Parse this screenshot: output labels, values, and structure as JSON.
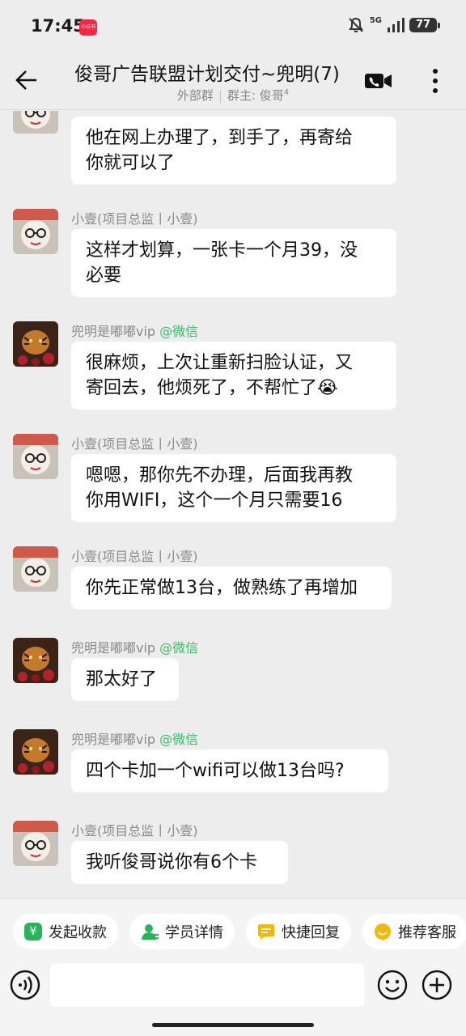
{
  "status_bar": {
    "time": "17:45",
    "app_badge": "小红书",
    "network": "5G",
    "battery": "77"
  },
  "header": {
    "title": "俊哥广告联盟计划交付~兜明(7)",
    "subtitle_group_type": "外部群",
    "subtitle_owner": "群主: 俊哥",
    "subtitle_owner_sup": "4"
  },
  "messages": [
    {
      "avatar": "avatar-glasses",
      "sender": "",
      "tag": "",
      "text_lines": [
        "他在网上办理了，到手了，再寄给",
        "你就可以了"
      ]
    },
    {
      "avatar": "avatar-glasses",
      "sender": "小壹(项目总监丨小壹)",
      "tag": "",
      "text_lines": [
        "这样才划算，一张卡一个月39，没",
        "必要"
      ]
    },
    {
      "avatar": "avatar-tiger",
      "sender": "兜明是嘟嘟vip ",
      "tag": "@微信",
      "text_lines": [
        "很麻烦，上次让重新扫脸认证，又",
        "寄回去，他烦死了，不帮忙了😭"
      ]
    },
    {
      "avatar": "avatar-glasses",
      "sender": "小壹(项目总监丨小壹)",
      "tag": "",
      "text_lines": [
        "嗯嗯，那你先不办理，后面我再教",
        "你用WIFI，这个一个月只需要16"
      ]
    },
    {
      "avatar": "avatar-glasses",
      "sender": "小壹(项目总监丨小壹)",
      "tag": "",
      "text_lines": [
        "你先正常做13台，做熟练了再增加"
      ]
    },
    {
      "avatar": "avatar-tiger",
      "sender": "兜明是嘟嘟vip ",
      "tag": "@微信",
      "text_lines": [
        "那太好了"
      ]
    },
    {
      "avatar": "avatar-tiger",
      "sender": "兜明是嘟嘟vip ",
      "tag": "@微信",
      "text_lines": [
        "四个卡加一个wifi可以做13台吗?"
      ]
    },
    {
      "avatar": "avatar-glasses",
      "sender": "小壹(项目总监丨小壹)",
      "tag": "",
      "text_lines": [
        "我听俊哥说你有6个卡"
      ]
    }
  ],
  "quick_actions": [
    {
      "label": "发起收款",
      "icon": "yuan-icon",
      "color": "#2bb35a"
    },
    {
      "label": "学员详情",
      "icon": "user-icon",
      "color": "#2bb35a"
    },
    {
      "label": "快捷回复",
      "icon": "chat-icon",
      "color": "#f5b800"
    },
    {
      "label": "推荐客服",
      "icon": "smile-icon",
      "color": "#f5b800"
    }
  ],
  "input": {
    "placeholder": "",
    "value": ""
  }
}
